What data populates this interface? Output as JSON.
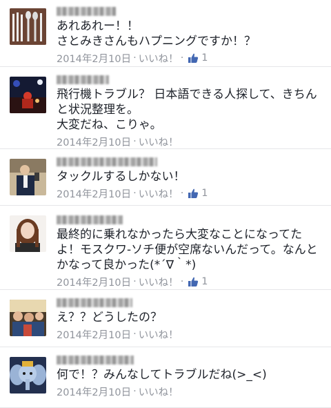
{
  "comments": [
    {
      "name": "",
      "text": "あれあれー！！\nさとみきさんもハプニングですか！？",
      "date": "2014年2月10日",
      "like_label": "いいね！",
      "like_count": "1",
      "avatar_icon": "utensils-photo-avatar"
    },
    {
      "name": "",
      "text": "飛行機トラブル？ 日本語できる人探して、きちん\nと状況整理を。\n大変だね、こりゃ。",
      "date": "2014年2月10日",
      "like_label": "いいね！",
      "like_count": "",
      "avatar_icon": "night-stage-photo-avatar"
    },
    {
      "name": "",
      "text": "タックルするしかない！",
      "date": "2014年2月10日",
      "like_label": "いいね！",
      "like_count": "1",
      "avatar_icon": "man-selfie-avatar"
    },
    {
      "name": "",
      "text": "最終的に乗れなかったら大変なことになってた\nよ！モスクワ-ソチ便が空席ないんだって。なんと\nかなって良かった(*´∇｀*)",
      "date": "2014年2月10日",
      "like_label": "いいね！",
      "like_count": "1",
      "avatar_icon": "woman-portrait-avatar"
    },
    {
      "name": "",
      "text": "え？？どうしたの？",
      "date": "2014年2月10日",
      "like_label": "いいね！",
      "like_count": "",
      "avatar_icon": "group-photo-avatar"
    },
    {
      "name": "",
      "text": "何で！？みんなしてトラブルだね(>_<)",
      "date": "2014年2月10日",
      "like_label": "いいね！",
      "like_count": "",
      "avatar_icon": "dumbo-photo-avatar"
    }
  ],
  "separator": "·",
  "colors": {
    "meta": "#90949c",
    "text": "#1d2129",
    "like_blue": "#4267b2",
    "divider": "#e5e6e9"
  }
}
